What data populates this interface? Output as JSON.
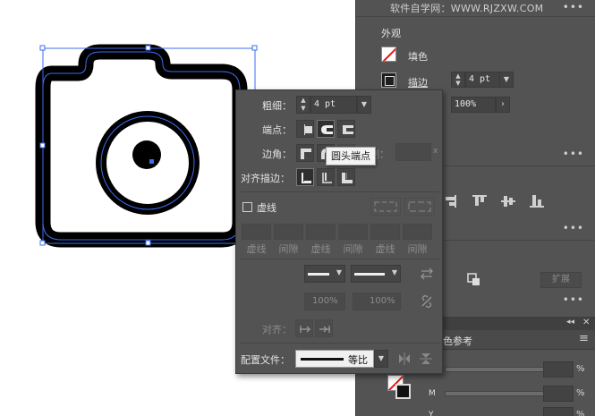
{
  "app": {
    "watermark": "软件自学网：WWW.RJZXW.COM"
  },
  "properties": {
    "appearance_label": "外观",
    "fill_label": "填色",
    "stroke_label": "描边",
    "stroke_weight": "4 pt",
    "opacity": "100%",
    "more": "•••",
    "expand_label": "扩展"
  },
  "lower_panel": {
    "tab_label": "色参考",
    "channels": [
      "M",
      "Y"
    ],
    "pct_sign": "%"
  },
  "stroke_panel": {
    "weight_label": "粗细：",
    "weight_value": "4 pt",
    "cap_label": "端点：",
    "corner_label": "边角：",
    "limit_label": "限制：",
    "limit_unit": "x",
    "align_label": "对齐描边：",
    "dashed_label": "虚线",
    "dash_headers": [
      "虚线",
      "间隙",
      "虚线",
      "间隙",
      "虚线",
      "间隙"
    ],
    "scale_1": "100%",
    "scale_2": "100%",
    "arrow_align_label": "对齐：",
    "profile_label": "配置文件：",
    "profile_value": "等比",
    "tooltip": "圆头端点"
  },
  "colors": {
    "panel_bg": "#535353",
    "selection_blue": "#3d6cf0",
    "artwork_black": "#000000",
    "fill_none_red": "#ee1111"
  }
}
